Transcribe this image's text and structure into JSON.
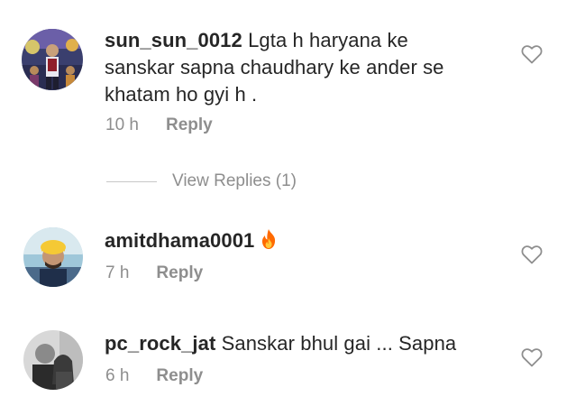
{
  "comments": [
    {
      "username": "sun_sun_0012",
      "text_line1": "Lgta h haryana ke",
      "text_line2": "sanskar sapna chaudhary ke ander se",
      "text_line3": "khatam ho gyi h .",
      "time": "10 h",
      "reply_label": "Reply",
      "view_replies_label": "View Replies (1)"
    },
    {
      "username": "amitdhama0001",
      "emoji": "fire-emoji",
      "time": "7 h",
      "reply_label": "Reply"
    },
    {
      "username": "pc_rock_jat",
      "text": "Sanskar bhul gai ... Sapna",
      "time": "6 h",
      "reply_label": "Reply"
    }
  ],
  "icons": {
    "like": "heart-outline-icon"
  },
  "colors": {
    "text": "#262626",
    "meta": "#8e8e8e",
    "heart": "#8e8e8e",
    "fire": "#ff6a00"
  }
}
